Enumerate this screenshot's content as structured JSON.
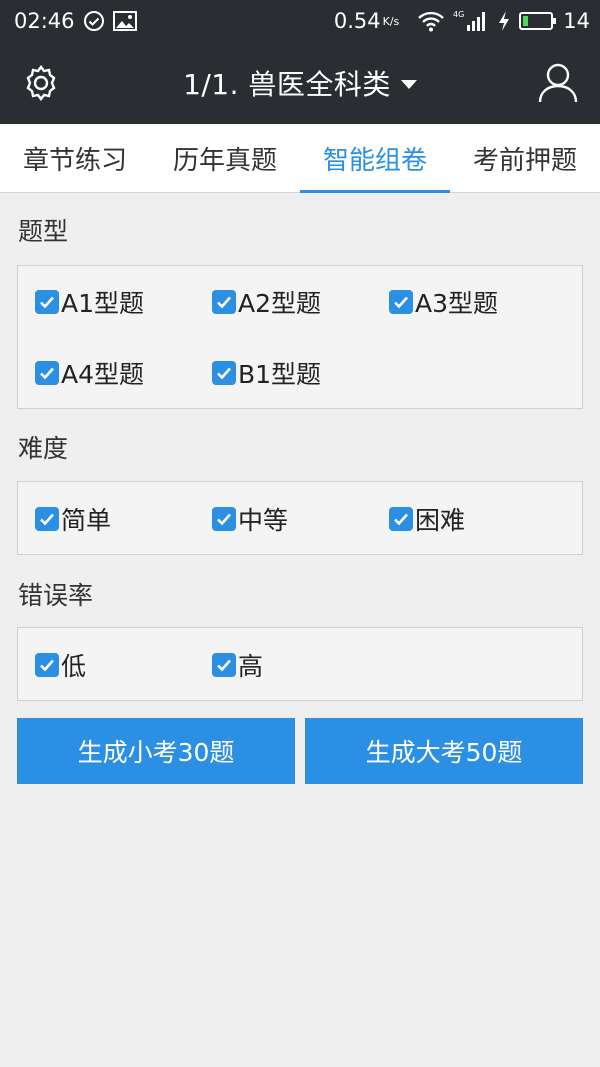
{
  "status_bar": {
    "time": "02:46",
    "speed": "0.54",
    "speed_unit": "K/s",
    "network": "4G",
    "battery": "14"
  },
  "app_bar": {
    "title": "1/1. 兽医全科类",
    "icons": [
      "gear-icon",
      "user-icon"
    ]
  },
  "tabs": [
    {
      "label": "章节练习",
      "active": false
    },
    {
      "label": "历年真题",
      "active": false
    },
    {
      "label": "智能组卷",
      "active": true
    },
    {
      "label": "考前押题",
      "active": false
    }
  ],
  "sections": {
    "question_type": {
      "title": "题型",
      "options": [
        {
          "label": "A1型题",
          "checked": true
        },
        {
          "label": "A2型题",
          "checked": true
        },
        {
          "label": "A3型题",
          "checked": true
        },
        {
          "label": "A4型题",
          "checked": true
        },
        {
          "label": "B1型题",
          "checked": true
        }
      ]
    },
    "difficulty": {
      "title": "难度",
      "options": [
        {
          "label": "简单",
          "checked": true
        },
        {
          "label": "中等",
          "checked": true
        },
        {
          "label": "困难",
          "checked": true
        }
      ]
    },
    "error_rate": {
      "title": "错误率",
      "options": [
        {
          "label": "低",
          "checked": true
        },
        {
          "label": "高",
          "checked": true
        }
      ]
    }
  },
  "buttons": {
    "small_exam": "生成小考30题",
    "big_exam": "生成大考50题"
  },
  "colors": {
    "accent": "#2b8fe4",
    "header_bg": "#2a2d31",
    "page_bg": "#efeff0"
  }
}
